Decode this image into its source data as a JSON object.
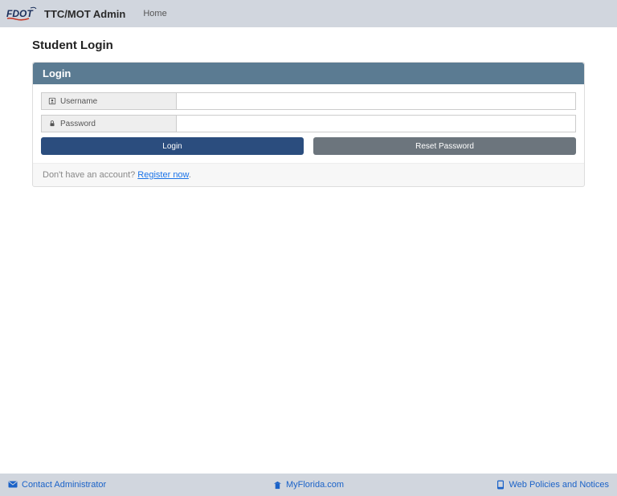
{
  "navbar": {
    "brand_title": "TTC/MOT Admin",
    "home_link": "Home"
  },
  "page": {
    "title": "Student Login"
  },
  "panel": {
    "heading": "Login",
    "username_label": "Username",
    "password_label": "Password",
    "login_button": "Login",
    "reset_button": "Reset Password",
    "footer_prompt": "Don't have an account? ",
    "register_link": "Register now",
    "footer_period": "."
  },
  "footer": {
    "contact": "Contact Administrator",
    "myflorida": "MyFlorida.com",
    "policies": "Web Policies and Notices"
  }
}
